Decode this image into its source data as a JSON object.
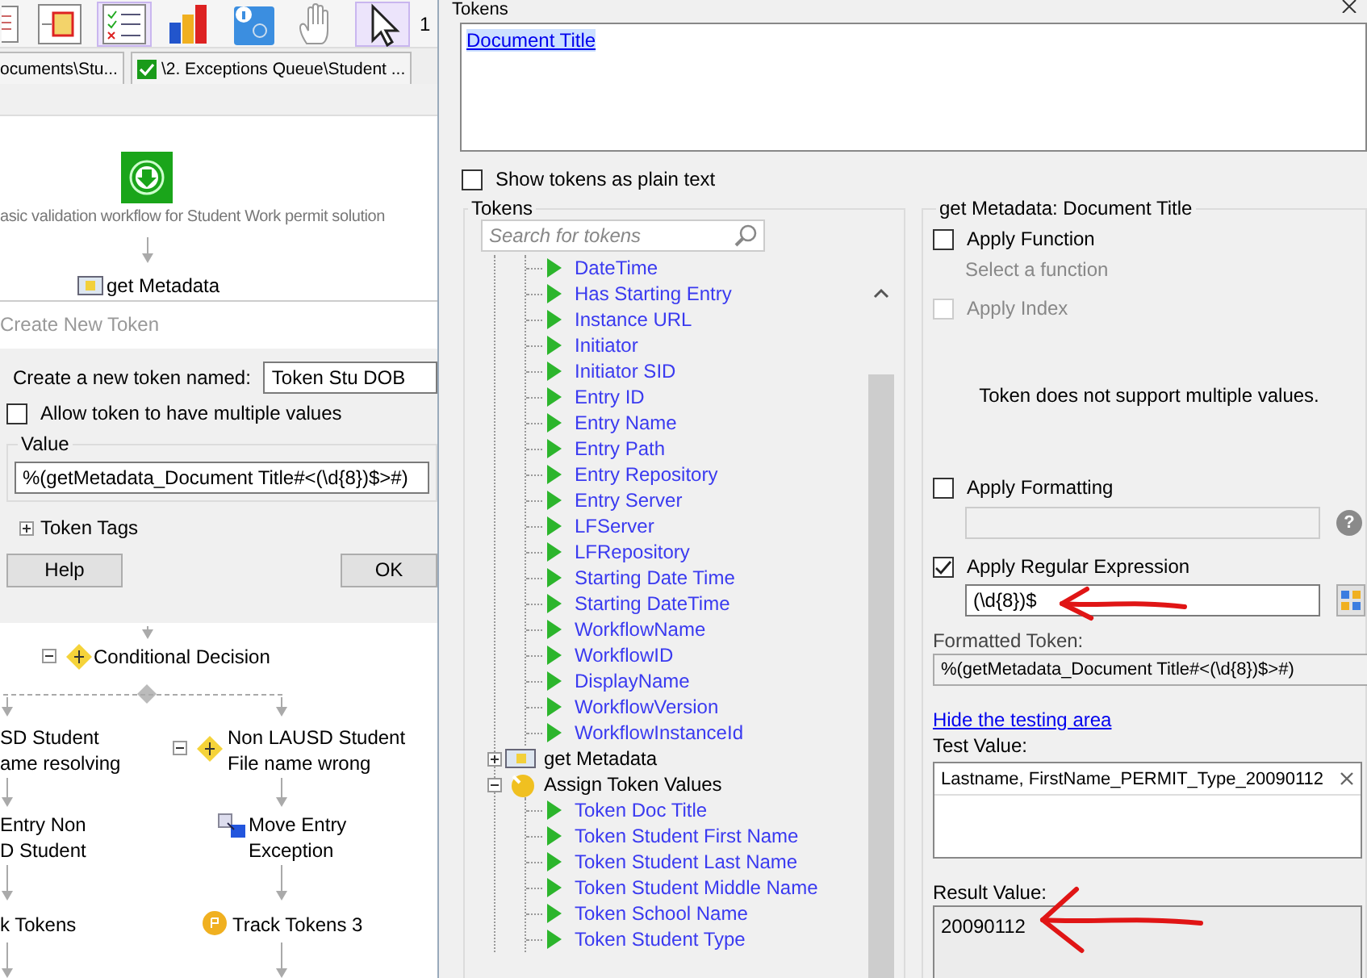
{
  "toolbar": {
    "buttons": [
      {
        "selected": false
      },
      {
        "selected": false
      },
      {
        "selected": true
      },
      {
        "selected": false
      },
      {
        "selected": false
      },
      {
        "selected": false
      },
      {
        "selected": true
      }
    ],
    "text": "1"
  },
  "doc_tabs": [
    {
      "label": "ocuments\\Stu...",
      "kind": "plain"
    },
    {
      "label": "\\2. Exceptions Queue\\Student ...",
      "kind": "checked"
    }
  ],
  "workflow": {
    "nodes": [
      {
        "kind": "start",
        "lines": [
          "asic validation workflow for Student Work permit solution"
        ]
      },
      {
        "kind": "metadata",
        "lines": [
          "get Metadata"
        ]
      },
      {
        "kind": "decision",
        "lines": [
          "Conditional Decision"
        ],
        "expanded": true
      },
      {
        "kind": "text",
        "lines": [
          "SD Student",
          "ame resolving"
        ]
      },
      {
        "kind": "text",
        "lines": [
          "Entry Non",
          "D Student"
        ]
      },
      {
        "kind": "text",
        "lines": [
          "k Tokens"
        ]
      },
      {
        "kind": "decision",
        "lines": [
          "Non LAUSD Student",
          "File name wrong"
        ],
        "expanded": true
      },
      {
        "kind": "move",
        "lines": [
          "Move Entry",
          "Exception"
        ]
      },
      {
        "kind": "track",
        "lines": [
          "Track Tokens 3"
        ]
      }
    ]
  },
  "create_token_dialog": {
    "title": "Create New Token",
    "name_label": "Create a new token named:",
    "name_value": "Token Stu DOB",
    "allow_multiple": {
      "label": "Allow token to have multiple values",
      "checked": false
    },
    "value_group": {
      "legend": "Value",
      "value": "%(getMetadata_Document Title#<(\\d{8})$>#)"
    },
    "token_tags": {
      "label": "Token Tags",
      "expanded": false
    },
    "buttons": [
      "Help",
      "OK"
    ]
  },
  "tokens_dialog": {
    "title": "Tokens",
    "token_text": "Document Title",
    "show_plain_text": {
      "label": "Show tokens as plain text",
      "checked": false
    },
    "tokens_group": {
      "legend": "Tokens",
      "search_placeholder": "Search for tokens",
      "partial_children": [
        "DateTime",
        "Has Starting Entry",
        "Instance URL",
        "Initiator",
        "Initiator SID",
        "Entry ID",
        "Entry Name",
        "Entry Path",
        "Entry Repository",
        "Entry Server",
        "LFServer",
        "LFRepository",
        "Starting Date Time",
        "Starting DateTime",
        "WorkflowName",
        "WorkflowID",
        "DisplayName",
        "WorkflowVersion",
        "WorkflowInstanceId"
      ],
      "nodes": [
        {
          "label": "get Metadata",
          "kind": "metadata",
          "expanded": false
        },
        {
          "label": "Assign Token Values",
          "kind": "assign",
          "expanded": true,
          "children": [
            "Token Doc Title",
            "Token Student First Name",
            "Token Student Last Name",
            "Token Student Middle Name",
            "Token School Name",
            "Token Student Type"
          ]
        }
      ]
    },
    "settings": {
      "legend": "get Metadata: Document Title",
      "apply_function": {
        "label": "Apply Function",
        "checked": false,
        "disabled": false
      },
      "function_hint": "Select a function",
      "apply_index": {
        "label": "Apply Index",
        "checked": false,
        "disabled": true
      },
      "multiple_note": "Token does not support multiple values.",
      "apply_formatting": {
        "label": "Apply Formatting",
        "checked": false,
        "disabled": false
      },
      "help_glyph": "?",
      "apply_regex": {
        "label": "Apply Regular Expression",
        "checked": true,
        "disabled": false
      },
      "regex_value": "(\\d{8})$",
      "formatted_label": "Formatted Token:",
      "formatted_value": "%(getMetadata_Document Title#<(\\d{8})$>#)",
      "testing_link": "Hide the testing area",
      "test_label": "Test Value:",
      "test_value": "Lastname, FirstName_PERMIT_Type_20090112",
      "result_label": "Result Value:",
      "result_value": "20090112"
    }
  }
}
